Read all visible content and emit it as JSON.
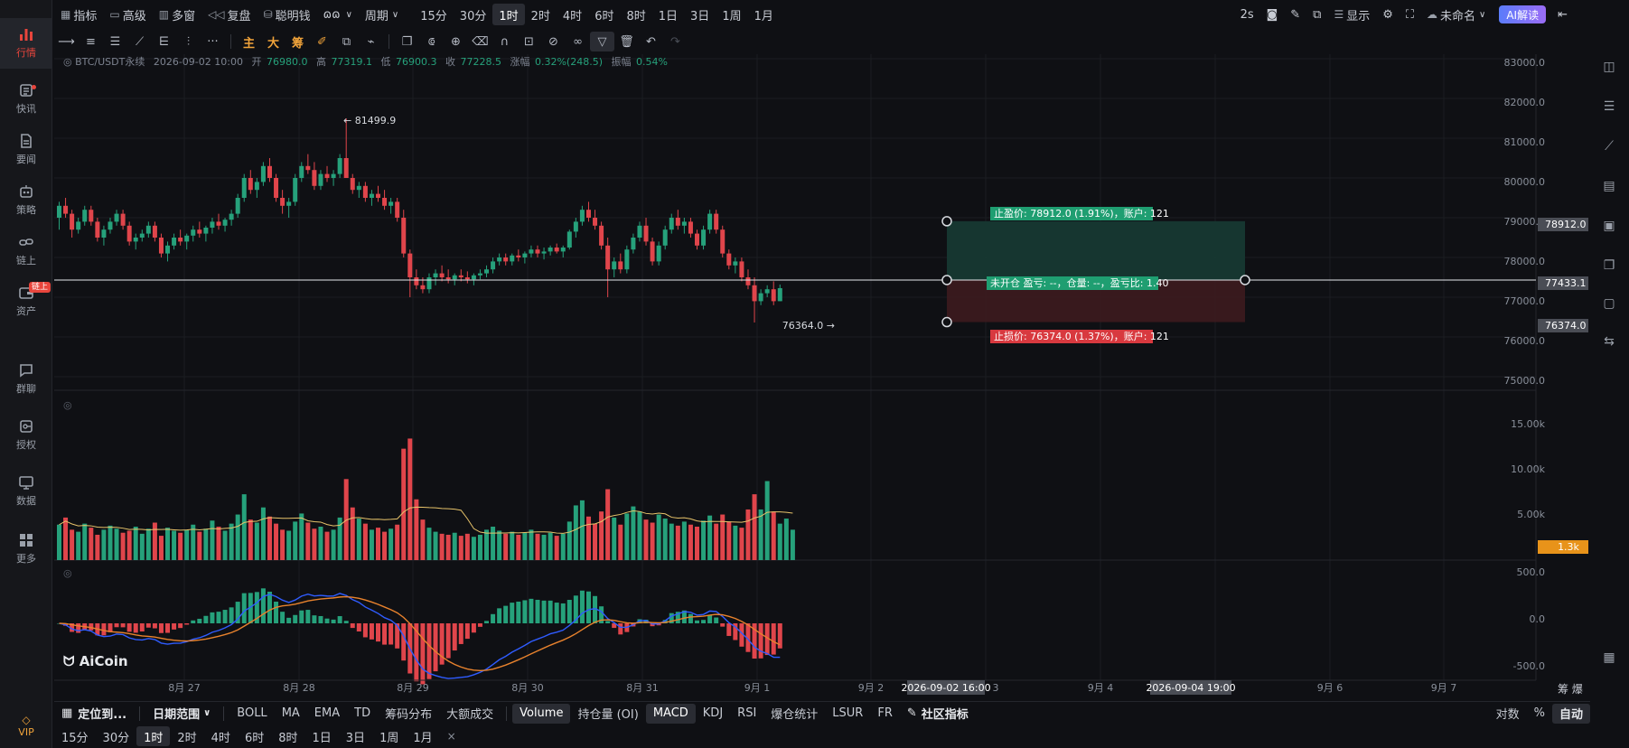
{
  "sidebar": {
    "items": [
      {
        "label": "行情",
        "icon": "chart-bars-icon",
        "active": true
      },
      {
        "label": "快讯",
        "icon": "news-flash-icon",
        "dot": true
      },
      {
        "label": "要闻",
        "icon": "document-icon"
      },
      {
        "label": "策略",
        "icon": "robot-icon"
      },
      {
        "label": "链上",
        "icon": "chain-icon"
      },
      {
        "label": "资产",
        "icon": "wallet-icon",
        "badge": "链上"
      },
      {
        "label": "群聊",
        "icon": "chat-icon"
      },
      {
        "label": "授权",
        "icon": "key-icon"
      },
      {
        "label": "数据",
        "icon": "data-screen-icon"
      },
      {
        "label": "更多",
        "icon": "grid-icon"
      }
    ],
    "vip": "VIP"
  },
  "topbar": {
    "indicator": "指标",
    "advanced": "高级",
    "multiwindow": "多窗",
    "replay": "复盘",
    "smart_money": "聪明钱",
    "period": "周期",
    "periods": [
      "15分",
      "30分",
      "1时",
      "2时",
      "4时",
      "6时",
      "8时",
      "1日",
      "3日",
      "1周",
      "1月"
    ],
    "active_period": "1时",
    "refresh": "2s",
    "display": "显示",
    "unnamed": "未命名",
    "ai": "AI解读"
  },
  "tools": {
    "main": "主",
    "big": "大",
    "chips": "筹"
  },
  "chart_data": {
    "type": "candlestick",
    "symbol_line": {
      "symbol": "BTC/USDT永续",
      "datetime": "2026-09-02 10:00",
      "open_label": "开",
      "open": "76980.0",
      "high_label": "高",
      "high": "77319.1",
      "low_label": "低",
      "low": "76900.3",
      "close_label": "收",
      "close": "77228.5",
      "change_label": "涨幅",
      "change": "0.32%(248.5)",
      "amplitude_label": "振幅",
      "amplitude": "0.54%"
    },
    "price_axis": [
      "83000.0",
      "82000.0",
      "81000.0",
      "80000.0",
      "79000.0",
      "78000.0",
      "77000.0",
      "76000.0",
      "75000.0"
    ],
    "price_range": [
      75000,
      83000
    ],
    "high_marker": "81499.9",
    "low_marker": "76364.0",
    "current_price": "77433.1",
    "take_profit_price": "78912.0",
    "stop_loss_price": "76374.0",
    "take_profit_label": "止盈价: 78912.0 (1.91%)，账户: 121",
    "position_label": "未开仓 盈亏: --，仓量: --，盈亏比: 1.40",
    "stop_loss_label": "止损价: 76374.0 (1.37%)，账户: 121",
    "volume_axis": [
      "15.00k",
      "10.00k",
      "5.00k"
    ],
    "volume_current": "1.3k",
    "macd_axis": [
      "500.0",
      "0.0",
      "-500.0"
    ],
    "date_axis": [
      "8月 27",
      "8月 28",
      "8月 29",
      "8月 30",
      "8月 31",
      "9月 1",
      "9月 2",
      "3",
      "9月 4",
      "9月 6",
      "9月 7"
    ],
    "crosshair_start": "2026-09-02 16:00",
    "crosshair_end": "2026-09-04 19:00",
    "axis_corner": "筹 爆",
    "watermark": "AiCoin",
    "colors": {
      "up": "#26a17b",
      "down": "#e0454b",
      "ma": "#e7c36a",
      "dif": "#2f5cff",
      "dea": "#e8822d",
      "tp_zone": "#173b33",
      "sl_zone": "#3d1b1e"
    },
    "candles": [
      [
        79000,
        79400,
        78700,
        79300
      ],
      [
        79300,
        79500,
        79000,
        79100
      ],
      [
        79100,
        79200,
        78500,
        78700
      ],
      [
        78700,
        79000,
        78600,
        78900
      ],
      [
        78900,
        79300,
        78800,
        79200
      ],
      [
        79200,
        79300,
        78800,
        78900
      ],
      [
        78900,
        79000,
        78400,
        78500
      ],
      [
        78500,
        78800,
        78300,
        78700
      ],
      [
        78700,
        79000,
        78600,
        78900
      ],
      [
        78900,
        79200,
        78800,
        79100
      ],
      [
        79100,
        79200,
        78700,
        78800
      ],
      [
        78800,
        78900,
        78300,
        78400
      ],
      [
        78400,
        78600,
        78200,
        78500
      ],
      [
        78500,
        78700,
        78400,
        78600
      ],
      [
        78600,
        78900,
        78500,
        78800
      ],
      [
        78800,
        78900,
        78400,
        78500
      ],
      [
        78500,
        78600,
        78000,
        78100
      ],
      [
        78100,
        78400,
        77900,
        78300
      ],
      [
        78300,
        78600,
        78200,
        78500
      ],
      [
        78500,
        78700,
        78300,
        78400
      ],
      [
        78400,
        78600,
        78200,
        78550
      ],
      [
        78550,
        78800,
        78400,
        78700
      ],
      [
        78700,
        78900,
        78500,
        78600
      ],
      [
        78600,
        78800,
        78400,
        78750
      ],
      [
        78750,
        79000,
        78600,
        78900
      ],
      [
        78900,
        79100,
        78700,
        78800
      ],
      [
        78800,
        79000,
        78650,
        78950
      ],
      [
        78950,
        79200,
        78800,
        79100
      ],
      [
        79100,
        79600,
        79000,
        79500
      ],
      [
        79500,
        80100,
        79400,
        80000
      ],
      [
        80000,
        80200,
        79600,
        79700
      ],
      [
        79700,
        80000,
        79500,
        79900
      ],
      [
        79900,
        80400,
        79800,
        80300
      ],
      [
        80300,
        80500,
        79900,
        80000
      ],
      [
        80000,
        80100,
        79400,
        79500
      ],
      [
        79500,
        79700,
        79100,
        79300
      ],
      [
        79300,
        79500,
        79000,
        79400
      ],
      [
        79400,
        80100,
        79300,
        80000
      ],
      [
        80000,
        80400,
        79900,
        80300
      ],
      [
        80300,
        80600,
        80100,
        80200
      ],
      [
        80200,
        80400,
        79700,
        79800
      ],
      [
        79800,
        80200,
        79700,
        80100
      ],
      [
        80100,
        80300,
        79900,
        80000
      ],
      [
        80000,
        80200,
        79800,
        80100
      ],
      [
        80100,
        80600,
        80000,
        80500
      ],
      [
        80500,
        81500,
        80300,
        80000
      ],
      [
        80000,
        80100,
        79600,
        79700
      ],
      [
        79700,
        79900,
        79500,
        79800
      ],
      [
        79800,
        79900,
        79400,
        79500
      ],
      [
        79500,
        79700,
        79300,
        79600
      ],
      [
        79600,
        79800,
        79400,
        79500
      ],
      [
        79500,
        79700,
        79200,
        79300
      ],
      [
        79300,
        79500,
        79100,
        79400
      ],
      [
        79400,
        79500,
        78900,
        79000
      ],
      [
        79000,
        79200,
        78000,
        78100
      ],
      [
        78100,
        78200,
        77000,
        77500
      ],
      [
        77500,
        77700,
        77200,
        77300
      ],
      [
        77300,
        77500,
        77100,
        77200
      ],
      [
        77200,
        77600,
        77100,
        77500
      ],
      [
        77500,
        77700,
        77300,
        77600
      ],
      [
        77600,
        77800,
        77400,
        77500
      ],
      [
        77500,
        77700,
        77350,
        77450
      ],
      [
        77450,
        77600,
        77300,
        77550
      ],
      [
        77550,
        77700,
        77400,
        77500
      ],
      [
        77500,
        77650,
        77350,
        77450
      ],
      [
        77450,
        77600,
        77300,
        77550
      ],
      [
        77550,
        77700,
        77450,
        77600
      ],
      [
        77600,
        77800,
        77500,
        77700
      ],
      [
        77700,
        78000,
        77600,
        77900
      ],
      [
        77900,
        78100,
        77800,
        78000
      ],
      [
        78000,
        78100,
        77800,
        77900
      ],
      [
        77900,
        78100,
        77800,
        78050
      ],
      [
        78050,
        78200,
        77900,
        78000
      ],
      [
        78000,
        78150,
        77850,
        78100
      ],
      [
        78100,
        78300,
        78000,
        78200
      ],
      [
        78200,
        78300,
        78000,
        78100
      ],
      [
        78100,
        78250,
        77950,
        78150
      ],
      [
        78150,
        78300,
        78050,
        78250
      ],
      [
        78250,
        78350,
        78100,
        78150
      ],
      [
        78150,
        78300,
        78000,
        78250
      ],
      [
        78250,
        78700,
        78200,
        78650
      ],
      [
        78650,
        79000,
        78500,
        78900
      ],
      [
        78900,
        79300,
        78800,
        79200
      ],
      [
        79200,
        79400,
        78900,
        79000
      ],
      [
        79000,
        79200,
        78700,
        78800
      ],
      [
        78800,
        78900,
        78200,
        78300
      ],
      [
        78300,
        78500,
        77000,
        77700
      ],
      [
        77700,
        78000,
        77500,
        77900
      ],
      [
        77900,
        78100,
        77600,
        77700
      ],
      [
        77700,
        78300,
        77600,
        78200
      ],
      [
        78200,
        78600,
        78100,
        78500
      ],
      [
        78500,
        78900,
        78400,
        78800
      ],
      [
        78800,
        79000,
        78300,
        78400
      ],
      [
        78400,
        78500,
        77800,
        77900
      ],
      [
        77900,
        78400,
        77800,
        78300
      ],
      [
        78300,
        78800,
        78200,
        78700
      ],
      [
        78700,
        79100,
        78600,
        79000
      ],
      [
        79000,
        79200,
        78700,
        78800
      ],
      [
        78800,
        79000,
        78600,
        78900
      ],
      [
        78900,
        79000,
        78500,
        78600
      ],
      [
        78600,
        78700,
        78200,
        78300
      ],
      [
        78300,
        78800,
        78200,
        78700
      ],
      [
        78700,
        79200,
        78600,
        79100
      ],
      [
        79100,
        79200,
        78600,
        78700
      ],
      [
        78700,
        78800,
        78000,
        78100
      ],
      [
        78100,
        78200,
        77700,
        77800
      ],
      [
        77800,
        78000,
        77600,
        77900
      ],
      [
        77900,
        78000,
        77400,
        77500
      ],
      [
        77500,
        77700,
        77200,
        77300
      ],
      [
        77300,
        77500,
        76364,
        76900
      ],
      [
        76900,
        77200,
        76800,
        77100
      ],
      [
        77100,
        77300,
        77000,
        77200
      ],
      [
        77200,
        77400,
        76800,
        76900
      ],
      [
        76900,
        77319,
        76900,
        77228
      ]
    ],
    "volumes": [
      3500,
      4200,
      3000,
      2800,
      3600,
      3200,
      2500,
      3000,
      3400,
      3100,
      2700,
      2900,
      3300,
      2600,
      3100,
      3700,
      2400,
      3200,
      2900,
      2700,
      3000,
      3500,
      2800,
      3100,
      3900,
      3300,
      2900,
      3600,
      4500,
      6500,
      4000,
      3700,
      5200,
      4300,
      3600,
      3000,
      2900,
      3800,
      4600,
      3700,
      3100,
      3300,
      2800,
      3000,
      4200,
      8000,
      5200,
      4100,
      3600,
      3000,
      3200,
      2800,
      3100,
      3500,
      11000,
      12000,
      6000,
      4000,
      3200,
      2800,
      2600,
      2500,
      2700,
      2400,
      2600,
      2300,
      2500,
      3000,
      3300,
      2900,
      2600,
      2800,
      2500,
      2700,
      3000,
      2600,
      2500,
      2700,
      2400,
      2600,
      3800,
      5400,
      5900,
      4300,
      3600,
      4800,
      7000,
      4200,
      3500,
      4600,
      5300,
      4800,
      4000,
      3700,
      4500,
      4100,
      3600,
      3400,
      3800,
      3500,
      3300,
      3900,
      4400,
      3600,
      4500,
      3800,
      3400,
      3200,
      5000,
      6500,
      5000,
      7800,
      4800,
      3600,
      4100,
      3000
    ]
  },
  "bottom": {
    "locate": "定位到...",
    "date_range": "日期范围",
    "indicators": [
      "BOLL",
      "MA",
      "EMA",
      "TD",
      "筹码分布",
      "大额成交"
    ],
    "sub_indicators": [
      "Volume",
      "持仓量 (OI)",
      "MACD",
      "KDJ",
      "RSI",
      "爆仓统计",
      "LSUR",
      "FR"
    ],
    "community": "社区指标",
    "log": "对数",
    "percent": "%",
    "auto": "自动",
    "periods": [
      "15分",
      "30分",
      "1时",
      "2时",
      "4时",
      "6时",
      "8时",
      "1日",
      "3日",
      "1周",
      "1月"
    ],
    "active_period": "1时",
    "close": "×"
  }
}
